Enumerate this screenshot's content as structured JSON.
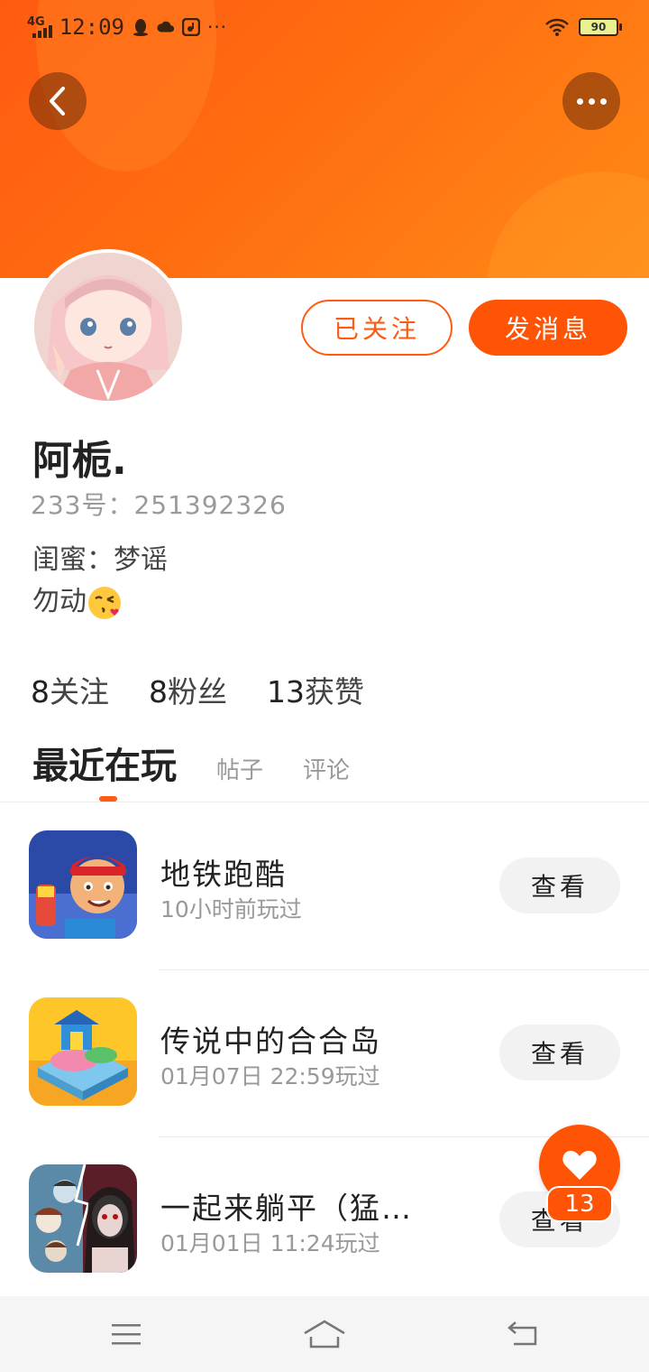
{
  "status_bar": {
    "network": "4G",
    "time": "12:09",
    "more": "···",
    "battery": "90"
  },
  "header": {
    "back_icon": "chevron-left-icon",
    "more_icon": "more-dots-icon",
    "accent_color": "#ff5a12"
  },
  "profile": {
    "avatar_icon": "anime-avatar-image",
    "follow_label": "已关注",
    "message_label": "发消息",
    "name": "阿栀.",
    "id_text": "233号：251392326",
    "bio_line1": "闺蜜：梦谣",
    "bio_line2": "勿动",
    "bio_emoji": "kissing-face-emoji"
  },
  "stats": {
    "following_count": "8",
    "following_label": "关注",
    "fans_count": "8",
    "fans_label": "粉丝",
    "likes_count": "13",
    "likes_label": "获赞"
  },
  "tabs": {
    "active": "最近在玩",
    "posts": "帖子",
    "comments": "评论"
  },
  "games": [
    {
      "name": "地铁跑酷",
      "time": "10小时前玩过",
      "button": "查看",
      "icon": "subway-surfers-icon"
    },
    {
      "name": "传说中的合合岛",
      "time": "01月07日 22:59玩过",
      "button": "查看",
      "icon": "merge-island-icon"
    },
    {
      "name": "一起来躺平（猛…",
      "time": "01月01日 11:24玩过",
      "button": "查看",
      "icon": "lie-flat-game-icon"
    }
  ],
  "like_fab": {
    "icon": "heart-icon",
    "count": "13"
  },
  "nav": {
    "menu_icon": "menu-icon",
    "home_icon": "home-icon",
    "back_icon": "back-icon"
  }
}
